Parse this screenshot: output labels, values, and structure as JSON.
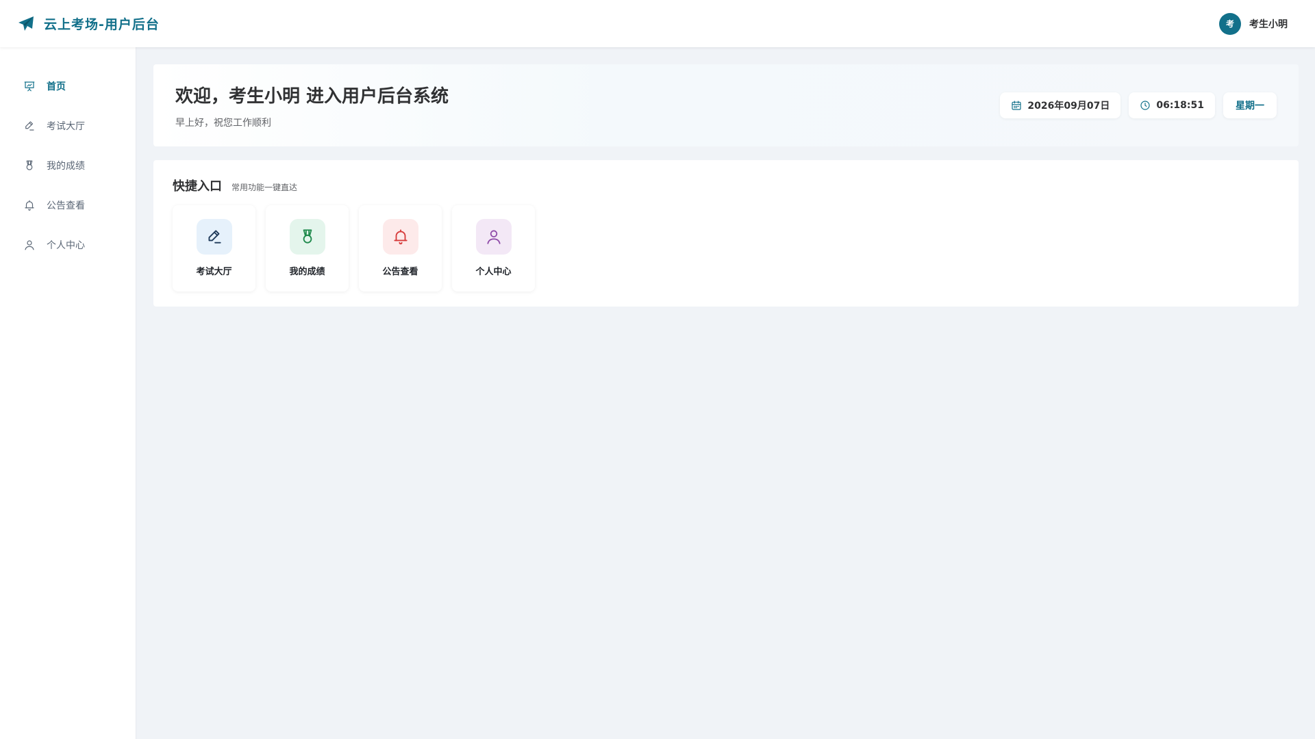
{
  "app": {
    "title": "云上考场-用户后台"
  },
  "user": {
    "avatar_text": "考",
    "name": "考生小明"
  },
  "sidebar": {
    "items": [
      {
        "label": "首页",
        "icon": "presentation-chart-icon",
        "active": true
      },
      {
        "label": "考试大厅",
        "icon": "pen-icon",
        "active": false
      },
      {
        "label": "我的成绩",
        "icon": "medal-icon",
        "active": false
      },
      {
        "label": "公告查看",
        "icon": "bell-icon",
        "active": false
      },
      {
        "label": "个人中心",
        "icon": "user-icon",
        "active": false
      }
    ]
  },
  "welcome": {
    "title": "欢迎，考生小明 进入用户后台系统",
    "subtitle": "早上好，祝您工作顺利",
    "date": "2026年09月07日",
    "time": "06:18:51",
    "weekday": "星期一"
  },
  "quick": {
    "title": "快捷入口",
    "subtitle": "常用功能一键直达",
    "tiles": [
      {
        "label": "考试大厅",
        "icon": "pen-icon",
        "bg": "#e6f1fb",
        "color": "#1f3a5a"
      },
      {
        "label": "我的成绩",
        "icon": "medal-icon",
        "bg": "#e4f5ec",
        "color": "#1f8a4c"
      },
      {
        "label": "公告查看",
        "icon": "bell-icon",
        "bg": "#fdeaea",
        "color": "#d63a3a"
      },
      {
        "label": "个人中心",
        "icon": "user-icon",
        "bg": "#f3e8f6",
        "color": "#8e4aa8"
      }
    ]
  },
  "colors": {
    "brand": "#12708a",
    "background": "#f0f3f7"
  }
}
